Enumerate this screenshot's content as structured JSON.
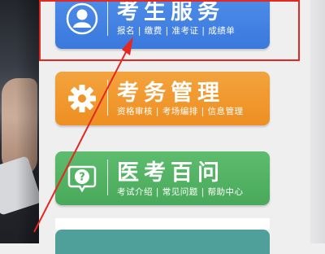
{
  "cards": [
    {
      "title": "考生服务",
      "links": [
        "报名",
        "缴费",
        "准考证",
        "成绩单"
      ],
      "icon": "user-icon",
      "color": "#4a89e6"
    },
    {
      "title": "考务管理",
      "links": [
        "资格审核",
        "考场编排",
        "信息管理"
      ],
      "icon": "gear-icon",
      "color": "#f19a2f"
    },
    {
      "title": "医考百问",
      "links": [
        "考试介绍",
        "常见问题",
        "帮助中心"
      ],
      "icon": "question-bubble-icon",
      "color": "#56b566"
    }
  ],
  "colors": {
    "highlight": "#e4281f",
    "teal_card": "#4f9f9a"
  }
}
